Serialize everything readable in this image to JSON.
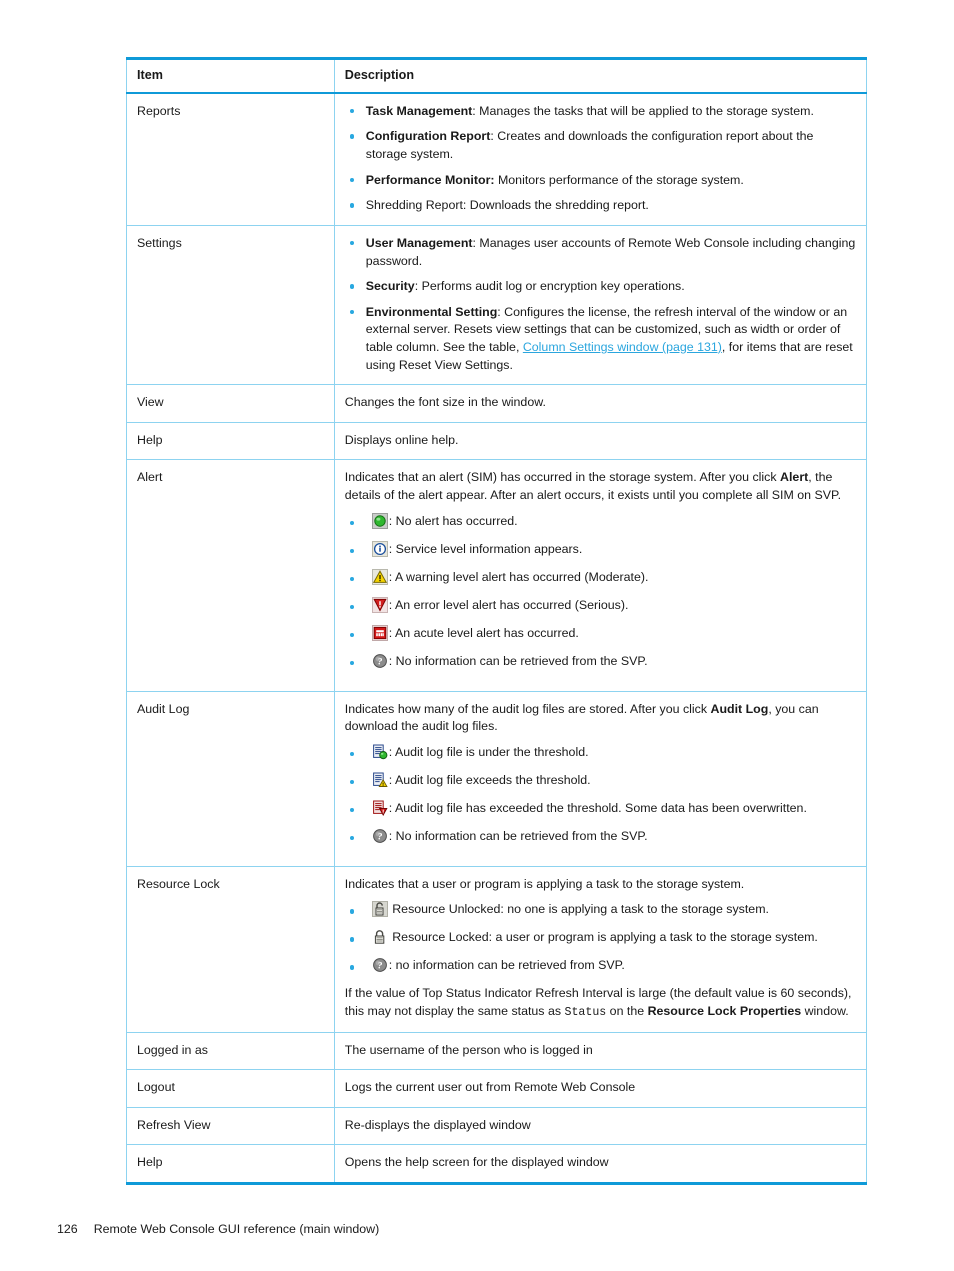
{
  "table": {
    "headers": {
      "item": "Item",
      "description": "Description"
    },
    "rows": [
      {
        "item": "Reports",
        "bullets": [
          {
            "bold": "Task Management",
            "text": ": Manages the tasks that will be applied to the storage system."
          },
          {
            "bold": "Configuration Report",
            "text": ": Creates and downloads the configuration report about the storage system."
          },
          {
            "bold": "Performance Monitor:",
            "text": " Monitors performance of the storage system."
          },
          {
            "bold": "",
            "text": "Shredding Report: Downloads the shredding report."
          }
        ]
      },
      {
        "item": "Settings",
        "bullets": [
          {
            "bold": "User Management",
            "text": ": Manages user accounts of Remote Web Console including changing password."
          },
          {
            "bold": "Security",
            "text": ": Performs audit log or encryption key operations."
          },
          {
            "bold": "Environmental Setting",
            "text": ": Configures the license, the refresh interval of the window or an external server. Resets view settings that can be customized, such as width or order of table column. See the table, ",
            "link": "Column Settings window (page 131)",
            "text_after": ", for items that are reset using Reset View Settings."
          }
        ]
      },
      {
        "item": "View",
        "paragraph": "Changes the font size in the window."
      },
      {
        "item": "Help",
        "paragraph": "Displays online help."
      },
      {
        "item": "Alert",
        "paragraph_pre": "Indicates that an alert (SIM) has occurred in the storage system. After you click ",
        "paragraph_bold": "Alert",
        "paragraph_post": ", the details of the alert appear. After an alert occurs, it exists until you complete all SIM on SVP.",
        "icon_bullets": [
          {
            "icon": "green-circle-icon",
            "text": ": No alert has occurred."
          },
          {
            "icon": "info-blue-icon",
            "text": ": Service level information appears."
          },
          {
            "icon": "warning-triangle-icon",
            "text": ": A warning level alert has occurred (Moderate)."
          },
          {
            "icon": "error-shield-icon",
            "text": ": An error level alert has occurred (Serious)."
          },
          {
            "icon": "acute-red-icon",
            "text": ": An acute level alert has occurred."
          },
          {
            "icon": "unknown-question-icon",
            "text": ": No information can be retrieved from the SVP."
          }
        ]
      },
      {
        "item": "Audit Log",
        "paragraph_pre": "Indicates how many of the audit log files are stored. After you click ",
        "paragraph_bold": "Audit Log",
        "paragraph_post": ", you can download the audit log files.",
        "icon_bullets": [
          {
            "icon": "log-green-icon",
            "text": ": Audit log file is under the threshold."
          },
          {
            "icon": "log-warning-icon",
            "text": ": Audit log file exceeds the threshold."
          },
          {
            "icon": "log-error-icon",
            "text": ": Audit log file has exceeded the threshold. Some data has been overwritten."
          },
          {
            "icon": "unknown-question-icon",
            "text": ": No information can be retrieved from the SVP."
          }
        ]
      },
      {
        "item": "Resource Lock",
        "paragraph": "Indicates that a user or program is applying a task to the storage system.",
        "icon_bullets": [
          {
            "icon": "lock-open-icon",
            "text": " Resource Unlocked: no one is applying a task to the storage system."
          },
          {
            "icon": "lock-closed-icon",
            "text": " Resource Locked: a user or program is applying a task to the storage system."
          },
          {
            "icon": "unknown-question-icon",
            "text": ": no information can be retrieved from SVP."
          }
        ],
        "trailing_pre": "If the value of Top Status Indicator Refresh Interval is large (the default value is 60 seconds), this may not display the same status as ",
        "trailing_mono": "Status",
        "trailing_mid": " on the ",
        "trailing_bold": "Resource Lock Properties",
        "trailing_post": " window."
      },
      {
        "item": "Logged in as",
        "paragraph": "The username of the person who is logged in"
      },
      {
        "item": "Logout",
        "paragraph": "Logs the current user out from Remote Web Console"
      },
      {
        "item": "Refresh View",
        "paragraph": "Re-displays the displayed window"
      },
      {
        "item": "Help",
        "paragraph": "Opens the help screen for the displayed window"
      }
    ]
  },
  "footer": {
    "page_number": "126",
    "chapter": "Remote Web Console GUI reference (main window)"
  },
  "colors": {
    "table_rule_strong": "#0f9ad8",
    "table_rule_light": "#8dd3f0",
    "bullet": "#29a8e0",
    "link": "#2ba6de",
    "text": "#1a1a1a"
  }
}
